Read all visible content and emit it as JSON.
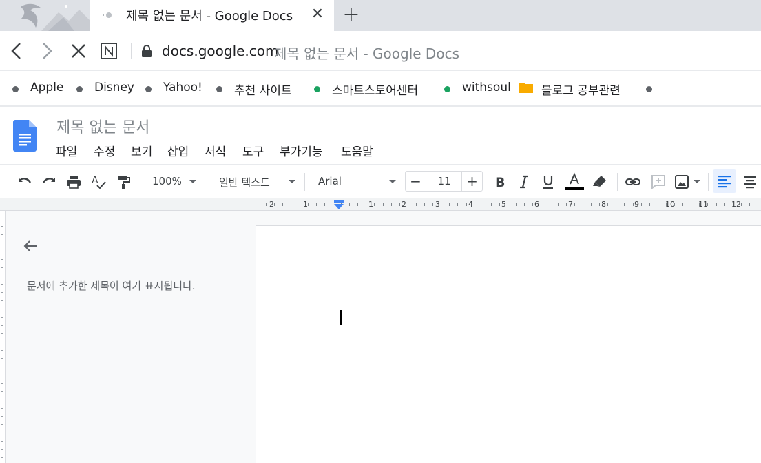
{
  "browser": {
    "tab": {
      "title": "제목 없는 문서 - Google Docs",
      "close_glyph": "✕"
    },
    "new_tab_glyph": "+",
    "address_bar": {
      "host": "docs.google.com",
      "page_title": "제목 없는 문서 - Google Docs"
    },
    "bookmarks": [
      {
        "label": "Apple",
        "icon": "dot-icon"
      },
      {
        "label": "Disney",
        "icon": "dot-icon"
      },
      {
        "label": "Yahoo!",
        "icon": "dot-icon"
      },
      {
        "label": "추천 사이트",
        "icon": "dot-icon"
      },
      {
        "label": "스마트스토어센터",
        "icon": "green-dot-icon"
      },
      {
        "label": "withsoul",
        "icon": "green-dot-icon"
      },
      {
        "label": "블로그 공부관련",
        "icon": "folder-icon"
      }
    ]
  },
  "docs": {
    "title": "제목 없는 문서",
    "menu": [
      "파일",
      "수정",
      "보기",
      "삽입",
      "서식",
      "도구",
      "부가기능",
      "도움말"
    ],
    "toolbar": {
      "zoom": "100%",
      "style": "일반 텍스트",
      "font": "Arial",
      "font_size": "11",
      "minus": "−",
      "plus": "+"
    },
    "ruler": [
      "2",
      "1",
      "1",
      "2",
      "3",
      "4",
      "5",
      "6",
      "7",
      "8",
      "9",
      "10",
      "11",
      "12"
    ],
    "outline_hint": "문서에 추가한 제목이 여기 표시됩니다."
  },
  "colors": {
    "accent_blue": "#4285f4",
    "green_dot": "#1aa260",
    "folder": "#f9ab00",
    "tab_strip": "#dee1e6"
  }
}
